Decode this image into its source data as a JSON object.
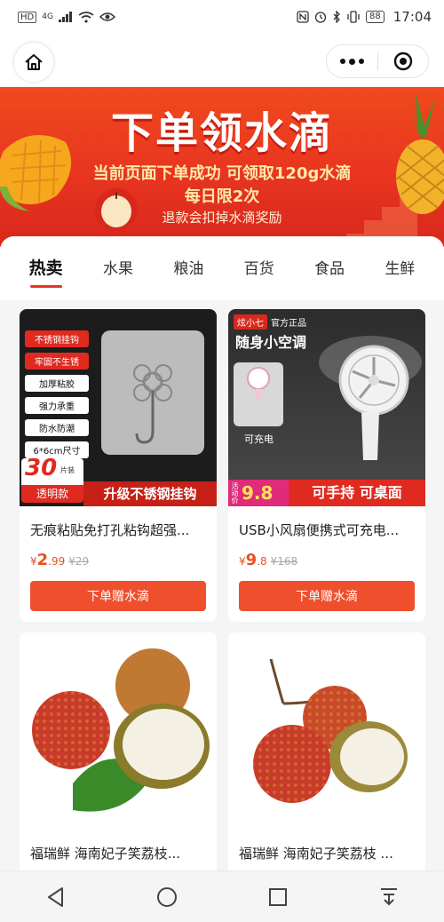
{
  "status_bar": {
    "left": "HD",
    "network": "4G",
    "battery": "88",
    "time": "17:04"
  },
  "banner": {
    "title": "下单领水滴",
    "line1": "当前页面下单成功 可领取120g水滴",
    "line2": "每日限2次",
    "line3": "退款会扣掉水滴奖励"
  },
  "tabs": [
    {
      "label": "热卖",
      "active": true
    },
    {
      "label": "水果"
    },
    {
      "label": "粮油"
    },
    {
      "label": "百货"
    },
    {
      "label": "食品"
    },
    {
      "label": "生鲜"
    }
  ],
  "products": [
    {
      "name": "无痕粘贴免打孔粘钩超强...",
      "price_symbol": "¥",
      "price_int": "2",
      "price_dec": ".99",
      "orig_price": "¥29",
      "button": "下单赠水滴",
      "image_text": {
        "tags": [
          "不锈钢挂钩",
          "牢固不生锈",
          "加厚粘胶",
          "强力承重",
          "防水防潮",
          "6*6cm尺寸"
        ],
        "count": "30",
        "count_unit": "片装",
        "badge": "透明款",
        "caption": "升级不锈钢挂钩"
      }
    },
    {
      "name": "USB小风扇便携式可充电...",
      "price_symbol": "¥",
      "price_int": "9",
      "price_dec": ".8",
      "orig_price": "¥168",
      "button": "下单赠水滴",
      "image_text": {
        "brand": "炫小七",
        "official": "官方正品",
        "headline": "随身小空调",
        "rechargeable": "可充电",
        "promo_label": "活动价",
        "promo_price": "9.8",
        "caption": "可手持 可桌面"
      }
    },
    {
      "name": "福瑞鲜 海南妃子笑荔枝..."
    },
    {
      "name": "福瑞鲜 海南妃子笑荔枝 ..."
    }
  ],
  "colors": {
    "accent": "#ef4f2c",
    "banner": "#e8351f",
    "price": "#e8501f"
  }
}
